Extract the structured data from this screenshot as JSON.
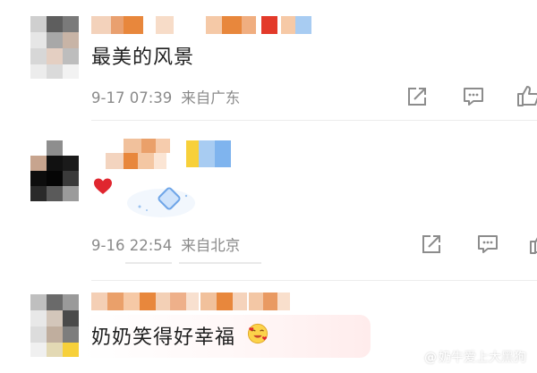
{
  "comments": [
    {
      "text": "最美的风景",
      "time": "9-17 07:39",
      "location": "来自广东"
    },
    {
      "text": "",
      "time": "9-16 22:54",
      "location": "来自北京"
    },
    {
      "text": "奶奶笑得好幸福",
      "time": "",
      "location": ""
    }
  ],
  "watermark": {
    "prefix": "@",
    "text": "奶牛爱上大黑狗"
  },
  "icons": {
    "share": "share-icon",
    "comment": "comment-icon",
    "like": "thumbs-up-icon",
    "heart": "heart-emoji-icon",
    "sticker": "diamond-sticker-icon",
    "emoji": "smiling-hearts-emoji-icon"
  },
  "colors": {
    "meta_text": "#8a8a8a",
    "icon": "#8c8c8c",
    "heart": "#e0262f",
    "mosaic_orange": "#e8873c",
    "mosaic_red": "#e33a2a",
    "mosaic_blue": "#7fb4ee",
    "mosaic_yellow": "#f7d03a"
  }
}
